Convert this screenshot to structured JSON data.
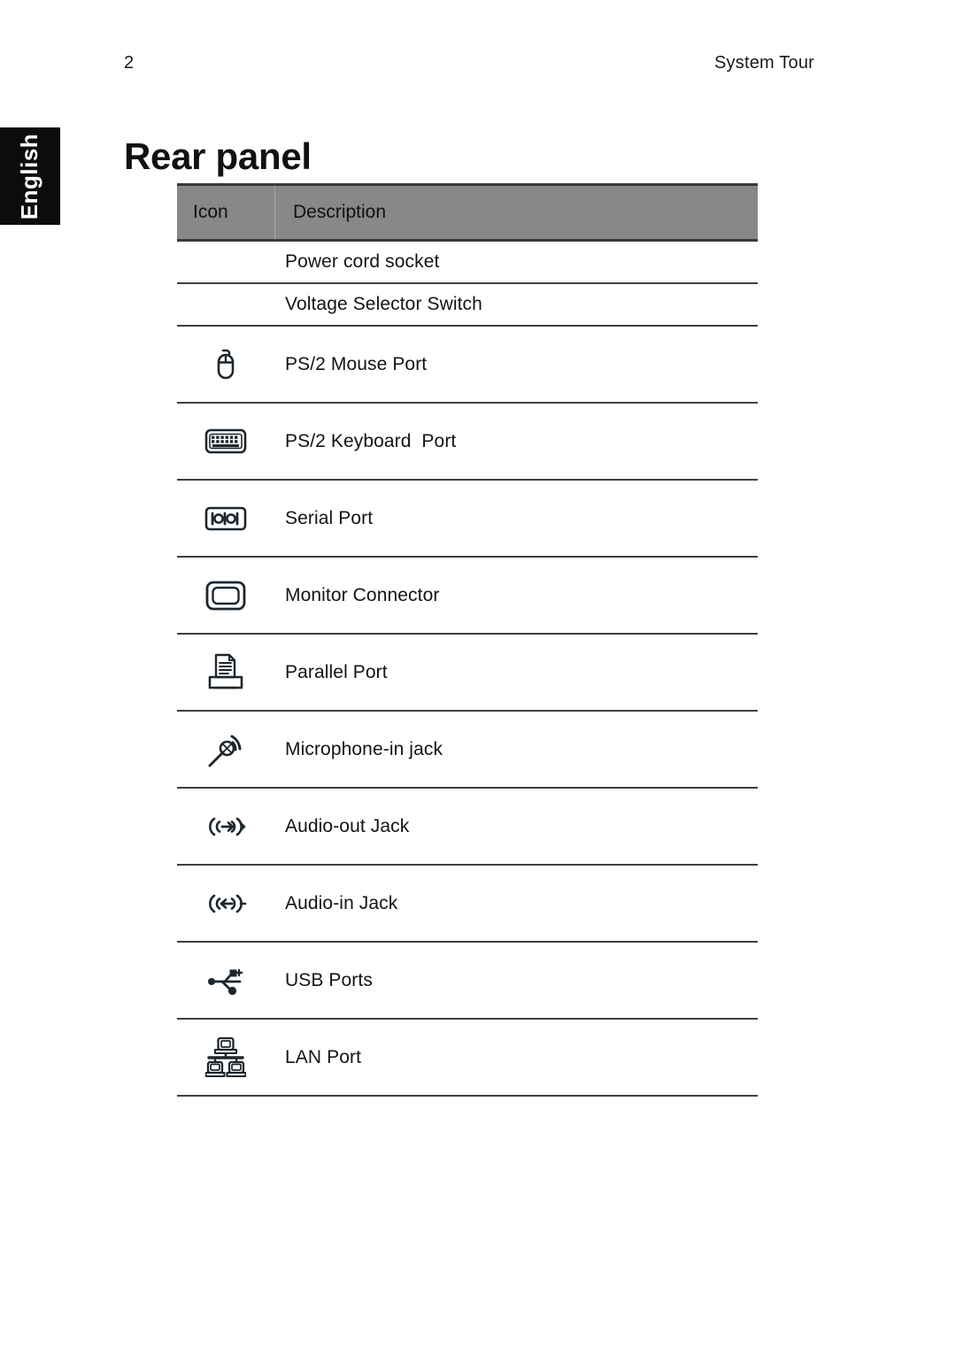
{
  "header": {
    "page_number": "2",
    "title": "System Tour"
  },
  "side_tab": {
    "label": "English"
  },
  "section": {
    "title": "Rear panel"
  },
  "table": {
    "columns": [
      {
        "key": "icon",
        "label": "Icon"
      },
      {
        "key": "description",
        "label": "Description"
      }
    ],
    "rows": [
      {
        "icon": null,
        "description": "Power cord socket"
      },
      {
        "icon": null,
        "description": "Voltage Selector Switch"
      },
      {
        "icon": "mouse-icon",
        "description": "PS/2 Mouse Port"
      },
      {
        "icon": "keyboard-icon",
        "description": "PS/2 Keyboard  Port"
      },
      {
        "icon": "serial-port-icon",
        "description": "Serial Port"
      },
      {
        "icon": "monitor-icon",
        "description": "Monitor Connector"
      },
      {
        "icon": "printer-icon",
        "description": "Parallel Port"
      },
      {
        "icon": "microphone-icon",
        "description": "Microphone-in jack"
      },
      {
        "icon": "audio-out-icon",
        "description": "Audio-out Jack"
      },
      {
        "icon": "audio-in-icon",
        "description": "Audio-in Jack"
      },
      {
        "icon": "usb-icon",
        "description": "USB Ports"
      },
      {
        "icon": "lan-icon",
        "description": "LAN Port"
      }
    ]
  },
  "colors": {
    "header_fill": "#888888",
    "rule": "#3f3f3f",
    "side_tab_bg": "#0c0c0c",
    "text": "#141414"
  }
}
